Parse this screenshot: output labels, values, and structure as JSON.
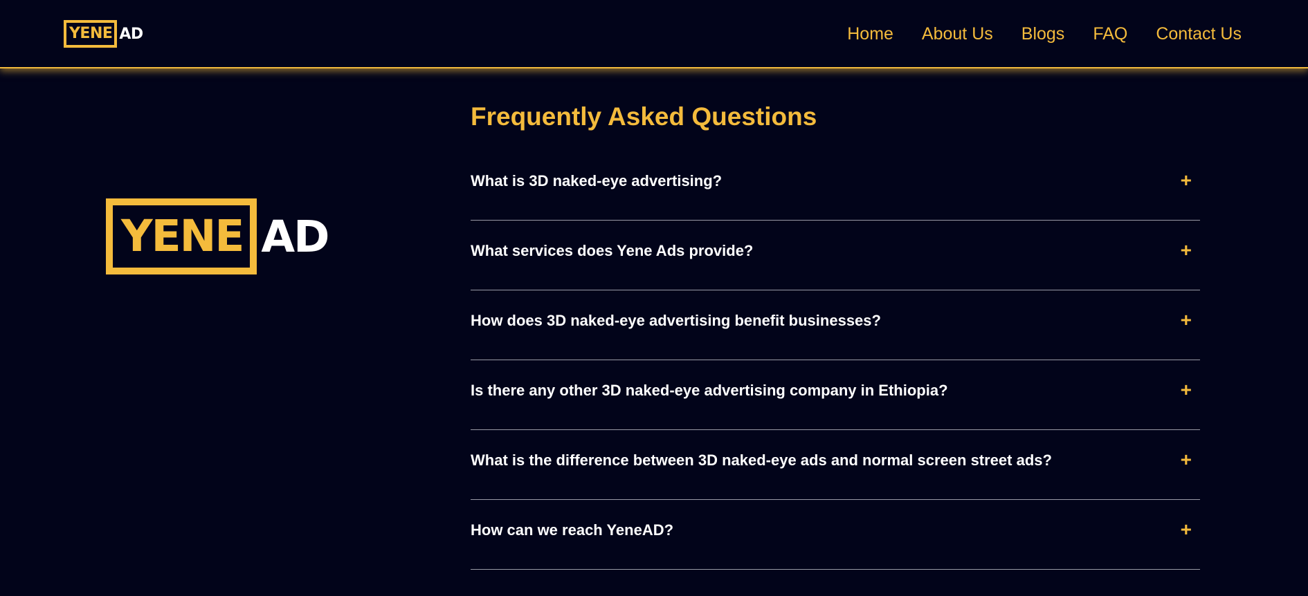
{
  "header": {
    "logo": {
      "boxed": "YENE",
      "rest": "AD"
    },
    "nav": [
      "Home",
      "About Us",
      "Blogs",
      "FAQ",
      "Contact Us"
    ]
  },
  "hero_logo": {
    "boxed": "YENE",
    "rest": "AD"
  },
  "faq": {
    "title": "Frequently Asked Questions",
    "items": [
      {
        "question": "What is 3D naked-eye advertising?",
        "toggle": "+"
      },
      {
        "question": "What services does Yene Ads provide?",
        "toggle": "+"
      },
      {
        "question": "How does 3D naked-eye advertising benefit businesses?",
        "toggle": "+"
      },
      {
        "question": "Is there any other 3D naked-eye advertising company in Ethiopia?",
        "toggle": "+"
      },
      {
        "question": "What is the difference between 3D naked-eye ads and normal screen street ads?",
        "toggle": "+"
      },
      {
        "question": "How can we reach YeneAD?",
        "toggle": "+"
      }
    ]
  },
  "colors": {
    "background": "#02041a",
    "accent": "#f4bb3c",
    "text": "#ffffff",
    "divider": "#9a9ba6"
  }
}
